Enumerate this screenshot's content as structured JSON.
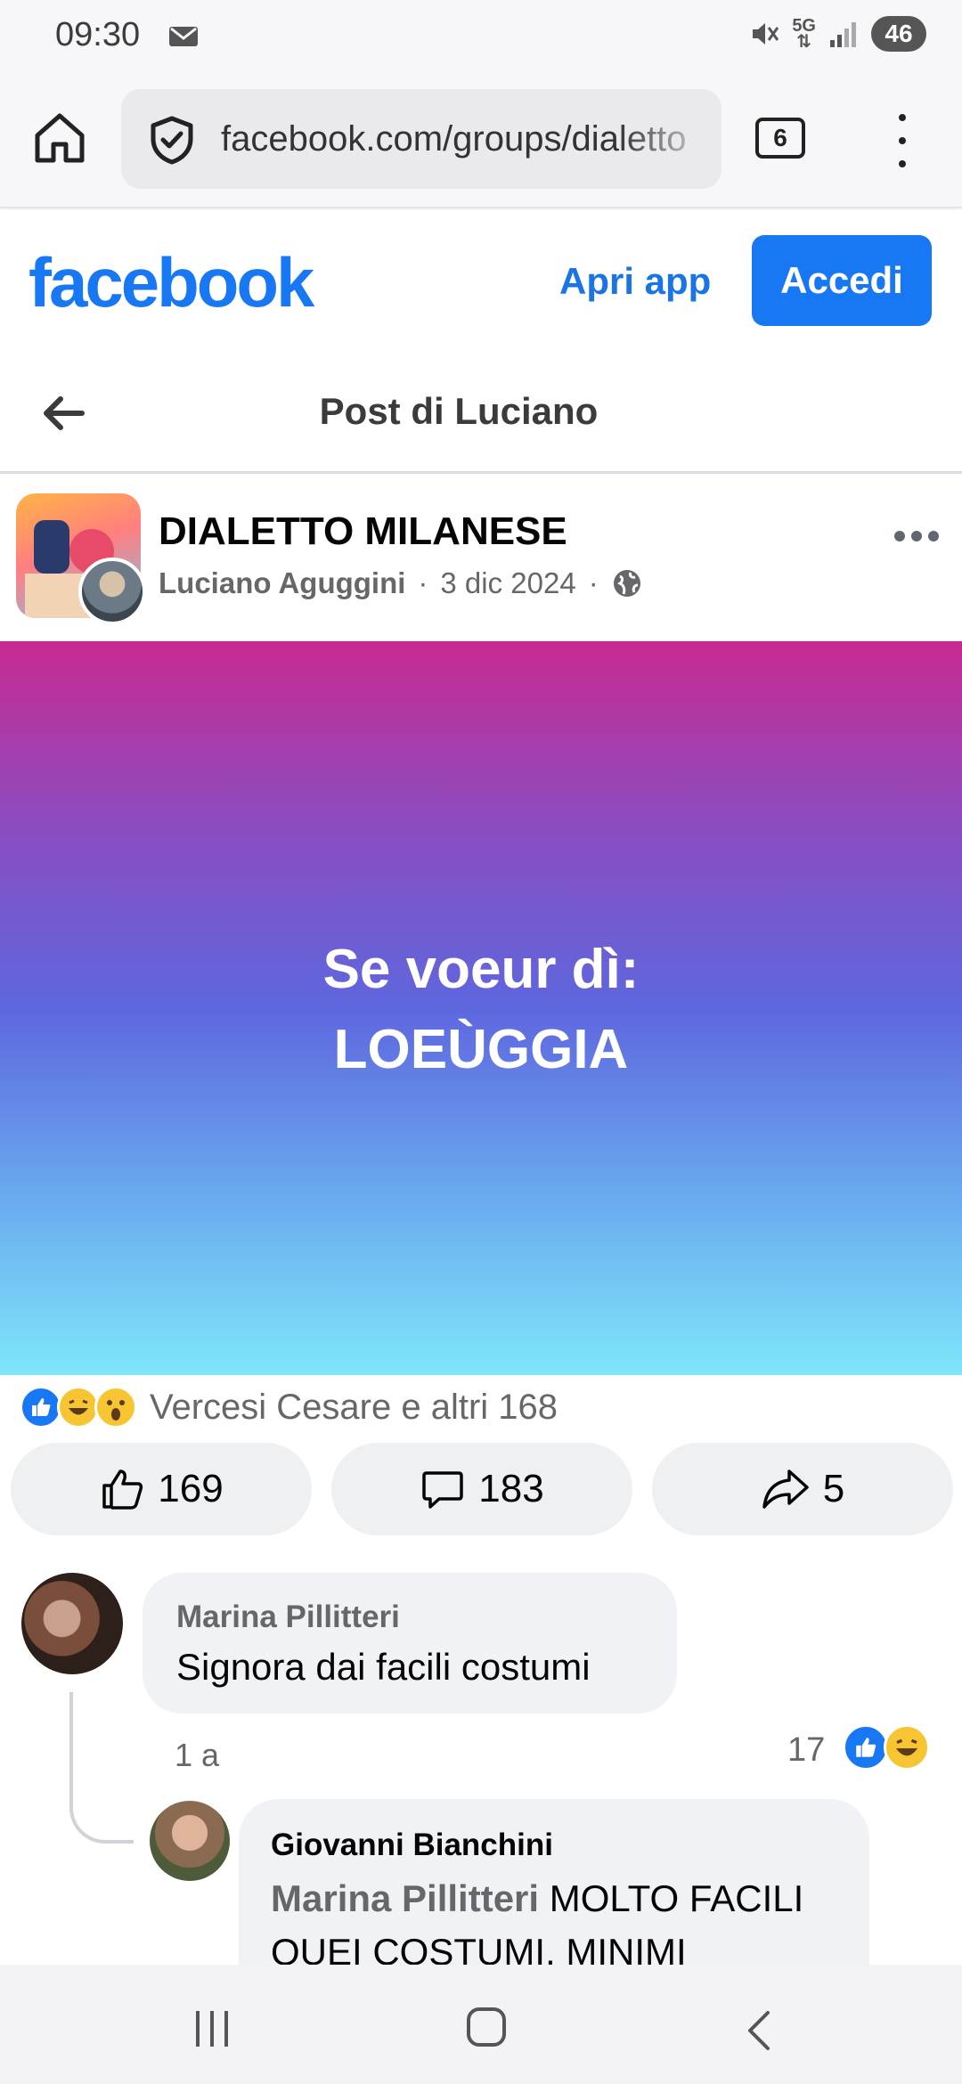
{
  "status_bar": {
    "time": "09:30",
    "battery": "46",
    "network": "5G"
  },
  "browser": {
    "url": "facebook.com/groups/dialetto",
    "tab_count": "6"
  },
  "header": {
    "logo": "facebook",
    "open_app": "Apri app",
    "login": "Accedi"
  },
  "page": {
    "title": "Post di Luciano"
  },
  "post": {
    "group_name": "DIALETTO MILANESE",
    "author": "Luciano Aguggini",
    "date": "3 dic 2024",
    "text_line1": "Se voeur dì:",
    "text_line2": "LOEÙGGIA",
    "background_colors": [
      "#c82a91",
      "#5e67de",
      "#7fe6fb"
    ]
  },
  "reactions": {
    "summary": "Vercesi Cesare e altri 168",
    "icons": [
      "like",
      "haha",
      "wow"
    ]
  },
  "actions": {
    "likes": "169",
    "comments": "183",
    "shares": "5"
  },
  "comments": [
    {
      "author": "Marina Pillitteri",
      "text": "Signora dai facili costumi",
      "time": "1 a",
      "reaction_count": "17"
    },
    {
      "author": "Giovanni Bianchini",
      "mention": "Marina Pillitteri",
      "text": "MOLTO FACILI QUEI COSTUMI, MINIMI"
    }
  ],
  "colors": {
    "brand": "#1877f2",
    "secondary_text": "#65676b",
    "bubble": "#f0f2f5"
  }
}
